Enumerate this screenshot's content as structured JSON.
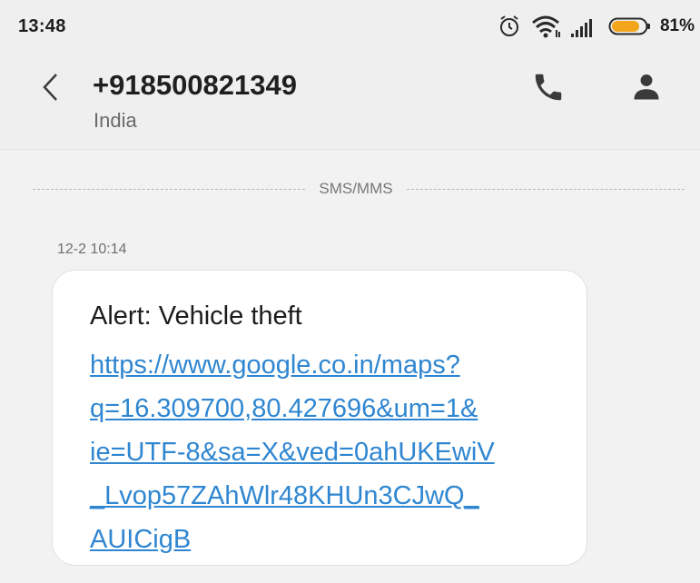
{
  "status_bar": {
    "time": "13:48",
    "battery_percent": "81%",
    "icons": [
      "alarm-icon",
      "wifi-icon",
      "signal-icon",
      "battery-icon"
    ],
    "battery_color": "#f3a51b"
  },
  "header": {
    "title": "+918500821349",
    "subtitle": "India",
    "actions": [
      "call-icon",
      "contact-icon"
    ]
  },
  "conversation": {
    "channel_label": "SMS/MMS",
    "timestamp": "12-2 10:14",
    "message": {
      "title": "Alert: Vehicle theft",
      "link_lines": [
        "https://www.google.co.in/maps?",
        "q=16.309700,80.427696&um=1&",
        "ie=UTF-8&sa=X&ved=0ahUKEwiV",
        "_Lvop57ZAhWlr48KHUn3CJwQ_",
        "AUICigB"
      ],
      "link_color": "#2f86d1"
    }
  }
}
